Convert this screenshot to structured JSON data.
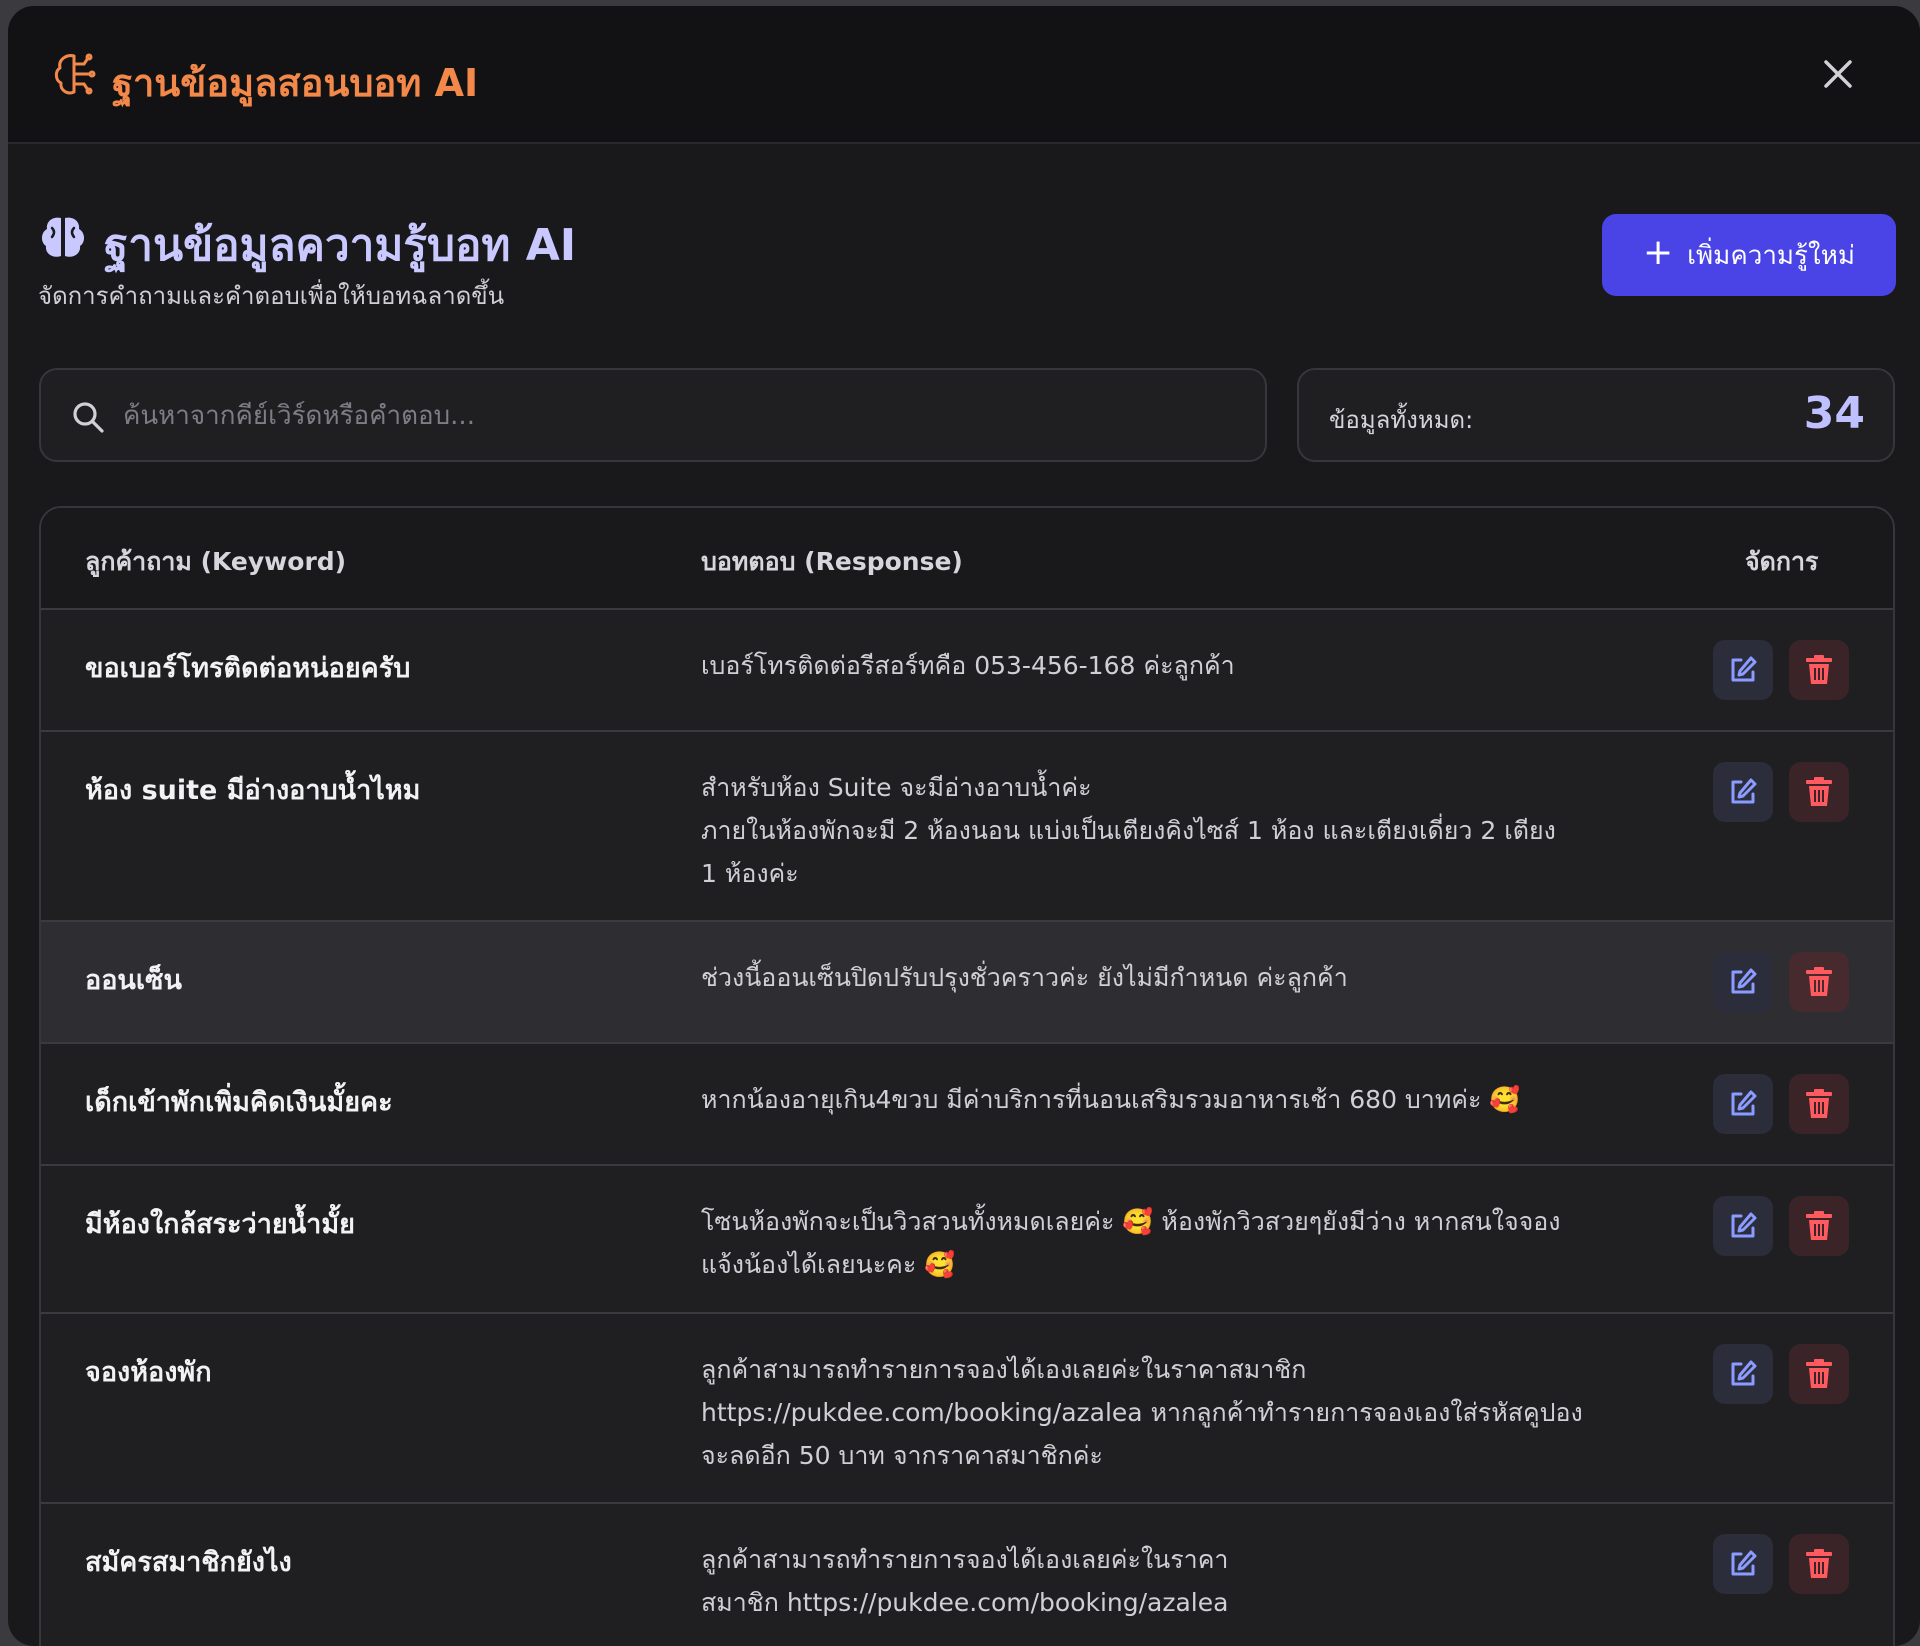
{
  "modal": {
    "title": "ฐานข้อมูลสอนบอท AI",
    "close_icon": "close-icon",
    "header_icon": "brain-circuit-icon"
  },
  "page": {
    "title": "ฐานข้อมูลความรู้บอท AI",
    "subtitle": "จัดการคำถามและคำตอบเพื่อให้บอทฉลาดขึ้น",
    "title_icon": "brain-icon",
    "add_button_label": "เพิ่มความรู้ใหม่"
  },
  "search": {
    "placeholder": "ค้นหาจากคีย์เวิร์ดหรือคำตอบ...",
    "value": ""
  },
  "stats": {
    "total_label": "ข้อมูลทั้งหมด:",
    "total_value": "34"
  },
  "table": {
    "headers": {
      "keyword": "ลูกค้าถาม (Keyword)",
      "response": "บอทตอบ (Response)",
      "actions": "จัดการ"
    },
    "rows": [
      {
        "keyword": "ขอเบอร์โทรติดต่อหน่อยครับ",
        "response": "เบอร์โทรติดต่อรีสอร์ทคือ 053-456-168 ค่ะลูกค้า"
      },
      {
        "keyword": "ห้อง suite มีอ่างอาบน้ำไหม",
        "response": "สำหรับห้อง Suite จะมีอ่างอาบน้ำค่ะ\nภายในห้องพักจะมี 2 ห้องนอน แบ่งเป็นเตียงคิงไซส์ 1 ห้อง และเตียงเดี่ยว 2 เตียง\n1  ห้องค่ะ"
      },
      {
        "keyword": "ออนเซ็น",
        "response": "ช่วงนี้ออนเซ็นปิดปรับปรุงชั่วคราวค่ะ ยังไม่มีกำหนด ค่ะลูกค้า"
      },
      {
        "keyword": "เด็กเข้าพักเพิ่มคิดเงินมั้ยคะ",
        "response": "หากน้องอายุเกิน4ขวบ มีค่าบริการที่นอนเสริมรวมอาหารเช้า 680 บาทค่ะ 🥰"
      },
      {
        "keyword": "มีห้องใกล้สระว่ายน้ำมั้ย",
        "response": "โซนห้องพักจะเป็นวิวสวนทั้งหมดเลยค่ะ 🥰  ห้องพักวิวสวยๆยังมีว่าง หากสนใจจอง\nแจ้งน้องได้เลยนะคะ 🥰"
      },
      {
        "keyword": "จองห้องพัก",
        "response": "ลูกค้าสามารถทำรายการจองได้เองเลยค่ะในราคาสมาชิก\nhttps://pukdee.com/booking/azalea หากลูกค้าทำรายการจองเองใส่รหัสคูปอง\nจะลดอีก 50 บาท จากราคาสมาชิกค่ะ"
      },
      {
        "keyword": "สมัครสมาชิกยังไง",
        "response": "ลูกค้าสามารถทำรายการจองได้เองเลยค่ะในราคา\nสมาชิก https://pukdee.com/booking/azalea"
      }
    ]
  },
  "colors": {
    "accent_orange": "#f2894a",
    "accent_indigo": "#4a44e6",
    "title_lavender": "#c9c9ff",
    "edit_icon": "#8a9cff",
    "delete_icon": "#ff5a5f"
  }
}
